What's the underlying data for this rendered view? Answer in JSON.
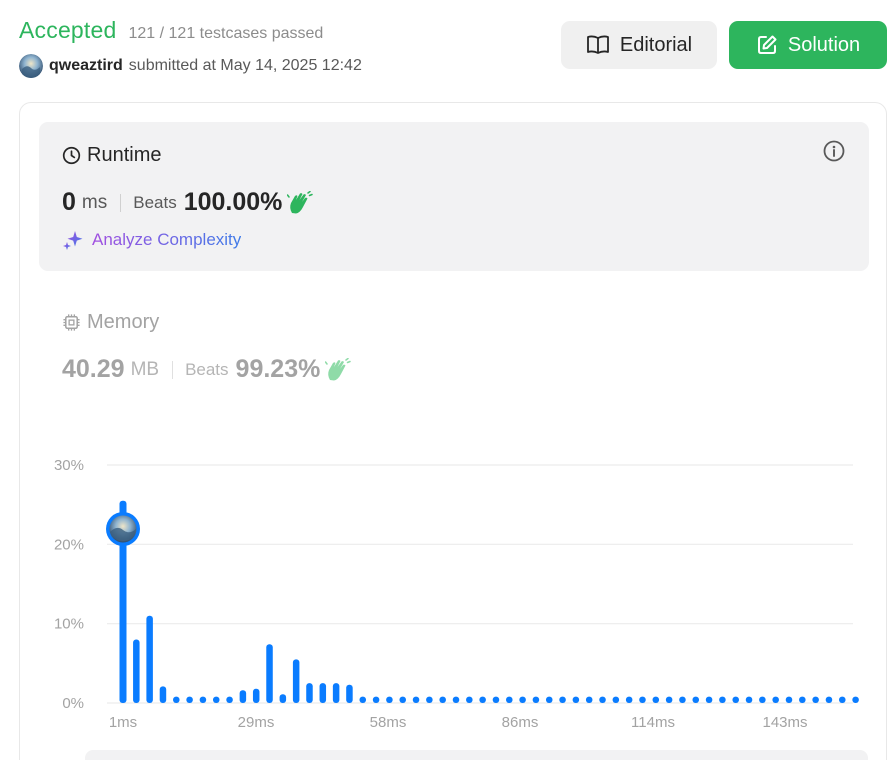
{
  "header": {
    "status": "Accepted",
    "testcases": "121 / 121 testcases passed",
    "username": "qweaztird",
    "submitted_text": "submitted at May 14, 2025 12:42"
  },
  "buttons": {
    "editorial": "Editorial",
    "solution": "Solution"
  },
  "runtime": {
    "title": "Runtime",
    "value": "0",
    "unit": "ms",
    "beats_label": "Beats",
    "beats_pct": "100.00%",
    "analyze_label": "Analyze Complexity"
  },
  "memory": {
    "title": "Memory",
    "value": "40.29",
    "unit": "MB",
    "beats_label": "Beats",
    "beats_pct": "99.23%"
  },
  "colors": {
    "accepted": "#2db55d",
    "bar": "#0a7cff",
    "analyze_start": "#a24fe0",
    "analyze_end": "#3f7be8"
  },
  "chart_data": {
    "type": "bar",
    "ylabels": [
      "30%",
      "20%",
      "10%",
      "0%"
    ],
    "xlabels": [
      "1ms",
      "29ms",
      "58ms",
      "86ms",
      "114ms",
      "143ms"
    ],
    "ylim": [
      0,
      30
    ],
    "grid": true,
    "highlight_index": 0,
    "values": [
      25.5,
      8.0,
      11.0,
      2.1,
      0.8,
      0.8,
      0.8,
      0.8,
      0.8,
      1.6,
      1.8,
      7.4,
      1.1,
      5.5,
      2.5,
      2.5,
      2.5,
      2.3,
      0.8,
      0.8,
      0.8,
      0.8,
      0.8,
      0.8,
      0.8,
      0.8,
      0.8,
      0.8,
      0.8,
      0.8,
      0.8,
      0.8,
      0.8,
      0.8,
      0.8,
      0.8,
      0.8,
      0.8,
      0.8,
      0.8,
      0.8,
      0.8,
      0.8,
      0.8,
      0.8,
      0.8,
      0.8,
      0.8,
      0.8,
      0.8,
      0.8,
      0.8,
      0.8,
      0.8,
      0.8,
      0.8
    ]
  }
}
